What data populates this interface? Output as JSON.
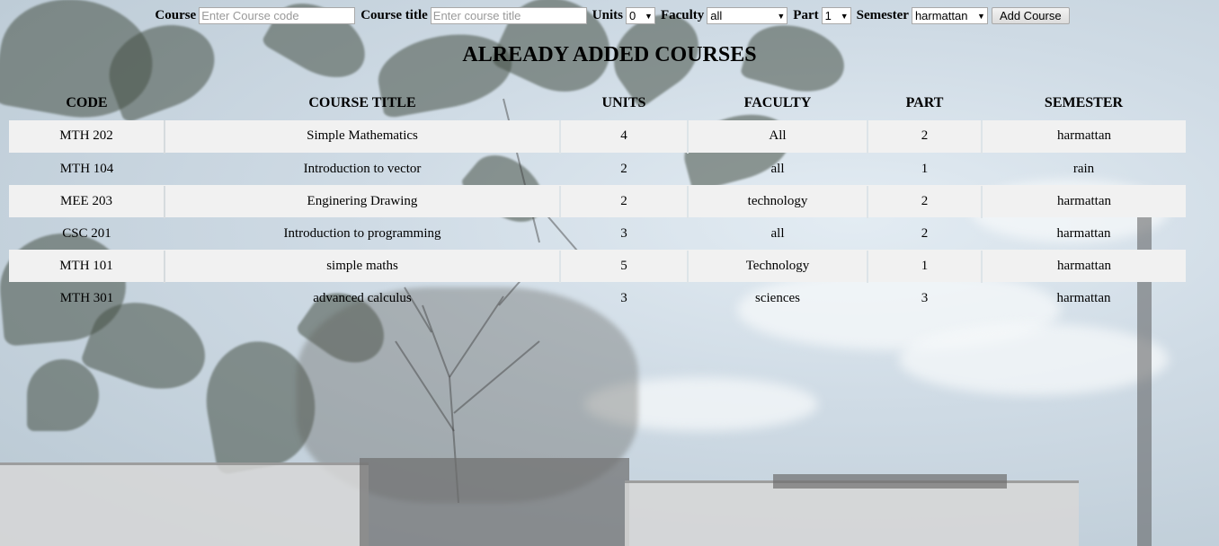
{
  "form": {
    "course_label": "Course",
    "course_placeholder": "Enter Course code",
    "course_title_label": "Course title",
    "course_title_placeholder": "Enter course title",
    "units_label": "Units",
    "units_value": "0",
    "faculty_label": "Faculty",
    "faculty_value": "all",
    "part_label": "Part",
    "part_value": "1",
    "semester_label": "Semester",
    "semester_value": "harmattan",
    "add_button": "Add Course"
  },
  "heading": "ALREADY ADDED COURSES",
  "table": {
    "headers": [
      "CODE",
      "COURSE TITLE",
      "UNITS",
      "FACULTY",
      "PART",
      "SEMESTER"
    ],
    "rows": [
      [
        "MTH 202",
        "Simple Mathematics",
        "4",
        "All",
        "2",
        "harmattan"
      ],
      [
        "MTH 104",
        "Introduction to vector",
        "2",
        "all",
        "1",
        "rain"
      ],
      [
        "MEE 203",
        "Enginering Drawing",
        "2",
        "technology",
        "2",
        "harmattan"
      ],
      [
        "CSC 201",
        "Introduction to programming",
        "3",
        "all",
        "2",
        "harmattan"
      ],
      [
        "MTH 101",
        "simple maths",
        "5",
        "Technology",
        "1",
        "harmattan"
      ],
      [
        "MTH 301",
        "advanced calculus",
        "3",
        "sciences",
        "3",
        "harmattan"
      ]
    ]
  },
  "colors": {
    "row_shade": "#f1f1f1"
  },
  "icons": {
    "select_arrow": "dropdown-arrow-icon"
  }
}
